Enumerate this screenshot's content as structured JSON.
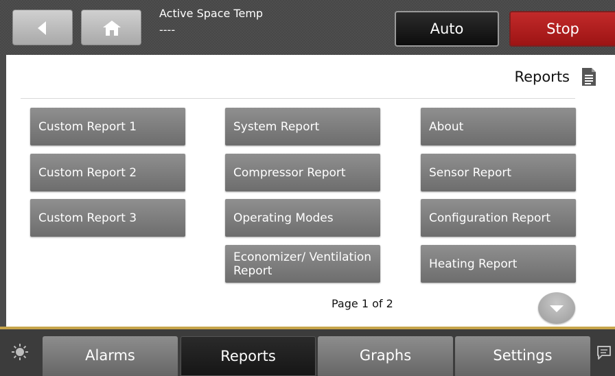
{
  "header": {
    "status_label": "Active Space Temp",
    "status_value": "----",
    "auto_label": "Auto",
    "stop_label": "Stop"
  },
  "page": {
    "title": "Reports",
    "pagination": "Page 1 of 2"
  },
  "reports": {
    "col1": [
      "Custom Report 1",
      "Custom Report 2",
      "Custom Report 3"
    ],
    "col2": [
      "System Report",
      "Compressor Report",
      "Operating Modes",
      "Economizer/ Ventilation Report"
    ],
    "col3": [
      "About",
      "Sensor Report",
      "Configuration Report",
      "Heating Report"
    ]
  },
  "tabs": [
    "Alarms",
    "Reports",
    "Graphs",
    "Settings"
  ],
  "active_tab": "Reports",
  "icons": [
    "back-arrow-icon",
    "home-icon",
    "document-icon",
    "chevron-down-icon",
    "sun-icon",
    "chat-icon"
  ],
  "colors": {
    "stop_red": "#b31f1f",
    "accent_gold": "#c6a44a",
    "button_gray": "#7e7e7e"
  }
}
